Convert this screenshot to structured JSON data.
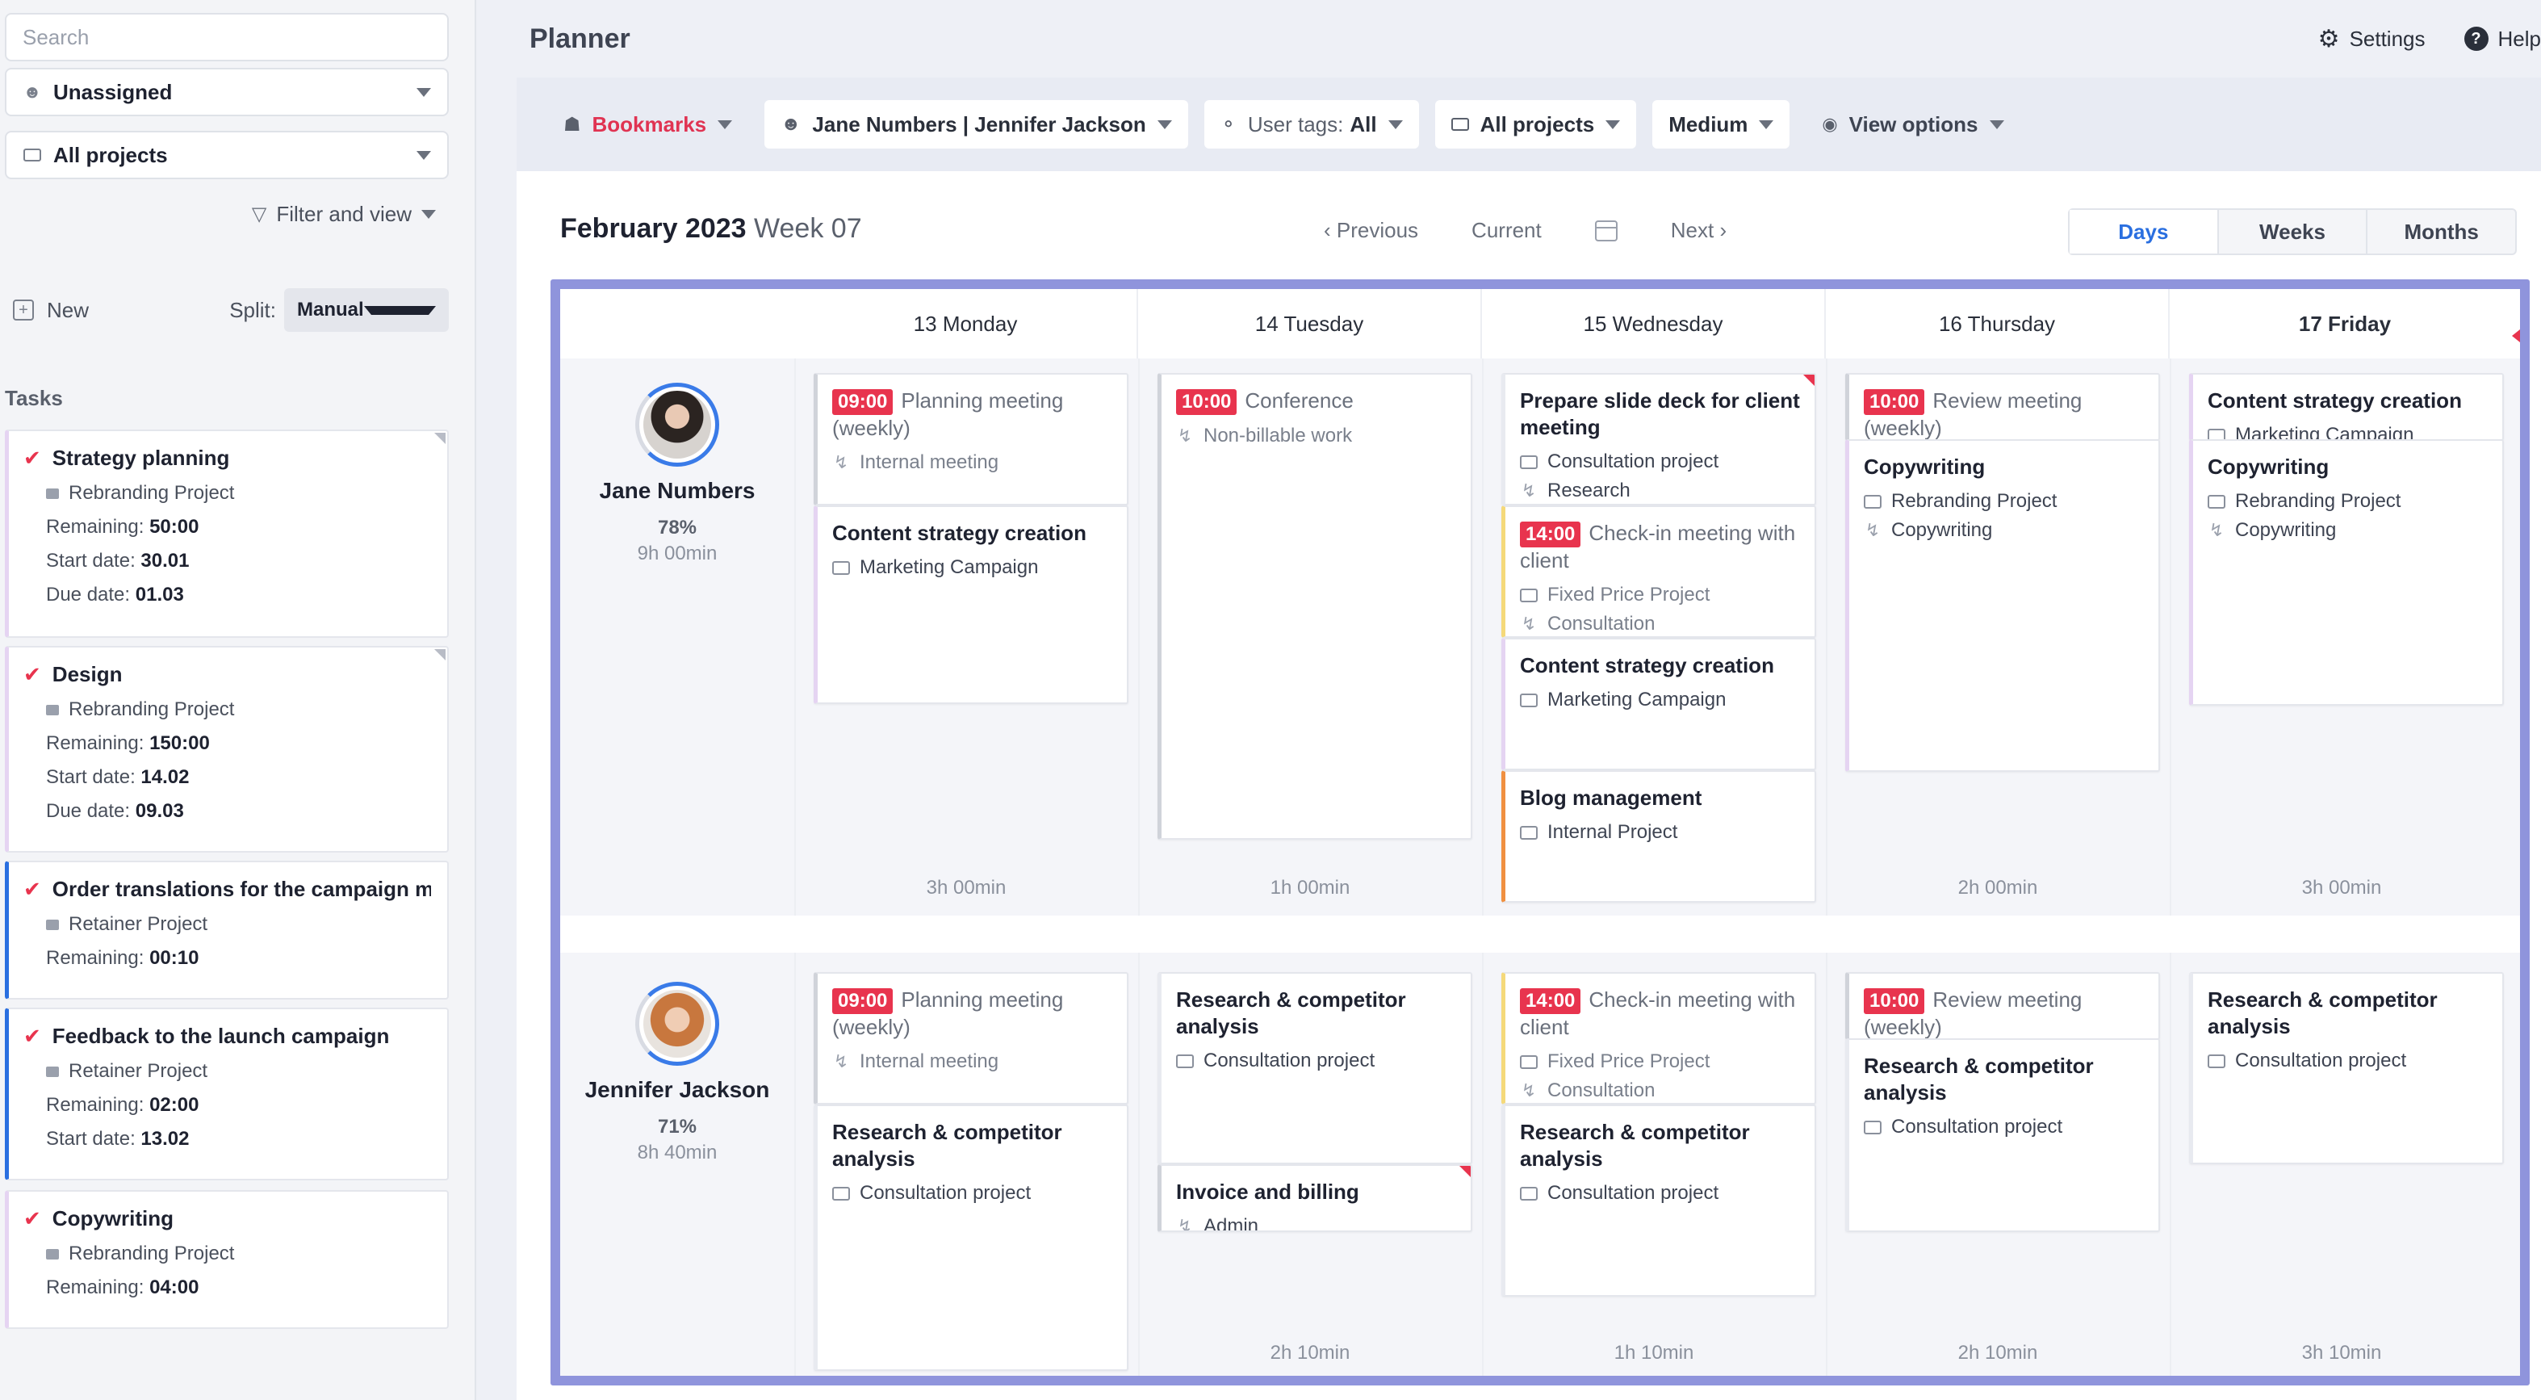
{
  "sidebar": {
    "search_placeholder": "Search",
    "assignee_select": "Unassigned",
    "projects_select": "All projects",
    "filter_view": "Filter and view",
    "new_label": "New",
    "split_label": "Split:",
    "split_value": "Manual",
    "tasks_heading": "Tasks",
    "tasks": [
      {
        "title": "Strategy planning",
        "project": "Rebranding Project",
        "remaining_label": "Remaining:",
        "remaining": "50:00",
        "start_label": "Start date:",
        "start": "30.01",
        "due_label": "Due date:",
        "due": "01.03"
      },
      {
        "title": "Design",
        "project": "Rebranding Project",
        "remaining_label": "Remaining:",
        "remaining": "150:00",
        "start_label": "Start date:",
        "start": "14.02",
        "due_label": "Due date:",
        "due": "09.03"
      },
      {
        "title": "Order translations for the campaign m...",
        "project": "Retainer Project",
        "remaining_label": "Remaining:",
        "remaining": "00:10"
      },
      {
        "title": "Feedback to the launch campaign",
        "project": "Retainer Project",
        "remaining_label": "Remaining:",
        "remaining": "02:00",
        "start_label": "Start date:",
        "start": "13.02"
      },
      {
        "title": "Copywriting",
        "project": "Rebranding Project",
        "remaining_label": "Remaining:",
        "remaining": "04:00"
      }
    ]
  },
  "header": {
    "title": "Planner",
    "settings": "Settings",
    "help": "Help"
  },
  "toolbar": {
    "bookmarks": "Bookmarks",
    "users": "Jane Numbers | Jennifer Jackson",
    "user_tags_label": "User tags:",
    "user_tags_value": "All",
    "projects": "All projects",
    "size": "Medium",
    "view_options": "View options"
  },
  "nav": {
    "month": "February 2023",
    "week": "Week 07",
    "previous": "Previous",
    "current": "Current",
    "next": "Next",
    "tabs": [
      "Days",
      "Weeks",
      "Months"
    ],
    "active_tab": "Days"
  },
  "days": [
    "13 Monday",
    "14 Tuesday",
    "15 Wednesday",
    "16 Thursday",
    "17 Friday"
  ],
  "users": [
    {
      "name": "Jane Numbers",
      "percent": "78%",
      "hours": "9h 00min",
      "totals": [
        "3h 00min",
        "1h 00min",
        "",
        "2h 00min",
        "3h 00min"
      ],
      "cards": {
        "mon": [
          {
            "time": "09:00",
            "title": "Planning meeting (weekly)",
            "meta1": "Internal meeting"
          },
          {
            "title": "Content strategy creation",
            "meta1": "Marketing Campaign"
          }
        ],
        "tue": [
          {
            "time": "10:00",
            "title": "Conference",
            "meta1": "Non-billable work"
          }
        ],
        "wed": [
          {
            "title": "Prepare slide deck for client meeting",
            "meta1": "Consultation project",
            "meta2": "Research"
          },
          {
            "time": "14:00",
            "title": "Check-in meeting with client",
            "meta1": "Fixed Price Project",
            "meta2": "Consultation"
          },
          {
            "title": "Content strategy creation",
            "meta1": "Marketing Campaign"
          },
          {
            "title": "Blog management",
            "meta1": "Internal Project"
          }
        ],
        "thu": [
          {
            "time": "10:00",
            "title": "Review meeting (weekly)"
          },
          {
            "title": "Copywriting",
            "meta1": "Rebranding Project",
            "meta2": "Copywriting"
          }
        ],
        "fri": [
          {
            "title": "Content strategy creation",
            "meta1": "Marketing Campaign"
          },
          {
            "title": "Copywriting",
            "meta1": "Rebranding Project",
            "meta2": "Copywriting"
          }
        ]
      }
    },
    {
      "name": "Jennifer Jackson",
      "percent": "71%",
      "hours": "8h 40min",
      "totals": [
        "",
        "2h 10min",
        "1h 10min",
        "2h 10min",
        "3h 10min"
      ],
      "cards": {
        "mon": [
          {
            "time": "09:00",
            "title": "Planning meeting (weekly)",
            "meta1": "Internal meeting"
          },
          {
            "title": "Research & competitor analysis",
            "meta1": "Consultation project"
          }
        ],
        "tue": [
          {
            "title": "Research & competitor analysis",
            "meta1": "Consultation project"
          },
          {
            "title": "Invoice and billing",
            "meta1": "Admin"
          }
        ],
        "wed": [
          {
            "time": "14:00",
            "title": "Check-in meeting with client",
            "meta1": "Fixed Price Project",
            "meta2": "Consultation"
          },
          {
            "title": "Research & competitor analysis",
            "meta1": "Consultation project"
          }
        ],
        "thu": [
          {
            "time": "10:00",
            "title": "Review meeting (weekly)"
          },
          {
            "title": "Research & competitor analysis",
            "meta1": "Consultation project"
          }
        ],
        "fri": [
          {
            "title": "Research & competitor analysis",
            "meta1": "Consultation project"
          }
        ]
      }
    }
  ],
  "colors": {
    "accent_red": "#e8344e",
    "active_tab_blue": "#2a6fe0",
    "grid_frame": "#8f94dc"
  }
}
